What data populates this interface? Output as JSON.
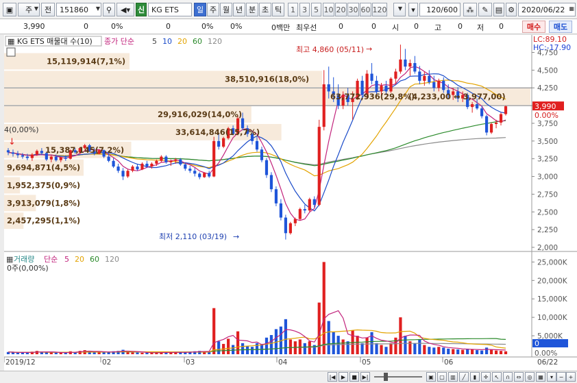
{
  "toolbar": {
    "period_label": "주",
    "prev_label": "전",
    "code_value": "151860",
    "trust_badge": "신",
    "stock_name": "KG ETS",
    "period_tabs": [
      "일",
      "주",
      "월",
      "년",
      "분",
      "초",
      "틱"
    ],
    "minute_options": [
      "1",
      "3",
      "5",
      "10",
      "20",
      "30",
      "60",
      "120"
    ],
    "count_display": "120",
    "count_total": "/600",
    "date_value": "2020/06/22"
  },
  "info": {
    "price": "3,990",
    "change": "0",
    "change_pct": "0%",
    "change2": "0",
    "change2_pct": "0%",
    "trade_value": "0백만",
    "best_ask_label": "최우선",
    "best_ask": "0",
    "best_ask2": "0",
    "open_label": "시",
    "open": "0",
    "high_label": "고",
    "high": "0",
    "low_label": "저",
    "low": "0",
    "buy_label": "매수",
    "sell_label": "매도"
  },
  "price_panel": {
    "title": "KG ETS 매물대 수(10)",
    "legend_prefix": "종가 단순",
    "ma_periods": [
      "5",
      "10",
      "20",
      "60",
      "120"
    ],
    "lc_label": "LC:89.10",
    "hc_label": "HC:-17.90",
    "last_price_tag": "3,990",
    "last_pct_tag": "0.00%",
    "start_marker": "4(0,00%)",
    "high_annotation": "최고 4,860 (05/11)",
    "low_annotation": "최저 2,110 (03/19)",
    "y_ticks": [
      "4,750",
      "4,500",
      "4,250",
      "4,000",
      "3,750",
      "3,500",
      "3,250",
      "3,000",
      "2,750",
      "2,500",
      "2,250",
      "2,000"
    ],
    "volume_profile": [
      {
        "label": "15,119,914(7,1%)",
        "price_low": 4500,
        "price_high": 4750,
        "share": 0.071
      },
      {
        "label": "38,510,916(18,0%)",
        "price_low": 4250,
        "price_high": 4500,
        "share": 0.18
      },
      {
        "label": "63,772,936(29,8%)",
        "price_low": 4000,
        "price_high": 4250,
        "share": 0.298
      },
      {
        "label": "29,916,029(14,0%)",
        "price_low": 3750,
        "price_high": 4000,
        "share": 0.14
      },
      {
        "label": "33,614,846(15,7%)",
        "price_low": 3500,
        "price_high": 3750,
        "share": 0.157
      },
      {
        "label": "15,387,145(7,2%)",
        "price_low": 3250,
        "price_high": 3500,
        "share": 0.072
      },
      {
        "label": "9,694,871(4,5%)",
        "price_low": 3000,
        "price_high": 3250,
        "share": 0.045
      },
      {
        "label": "1,952,375(0,9%)",
        "price_low": 2750,
        "price_high": 3000,
        "share": 0.009
      },
      {
        "label": "3,913,079(1,8%)",
        "price_low": 2500,
        "price_high": 2750,
        "share": 0.018
      },
      {
        "label": "2,457,295(1,1%)",
        "price_low": 2250,
        "price_high": 2500,
        "share": 0.011
      }
    ],
    "extra_label": "(4,233,00 ↔ 3,977,00)"
  },
  "volume_panel": {
    "title": "거래량",
    "legend_prefix": "단순",
    "ma_periods": [
      "5",
      "20",
      "60",
      "120"
    ],
    "start_marker": "0주(0,00%)",
    "y_ticks": [
      "25,000K",
      "20,000K",
      "15,000K",
      "10,000K",
      "5,000K",
      "0.00%"
    ],
    "last_tag": "0"
  },
  "x_axis": {
    "labels": [
      "2019/12",
      "02",
      "03",
      "04",
      "05",
      "06",
      "06/22"
    ]
  },
  "colors": {
    "up": "#e02020",
    "down": "#1f55d9",
    "ma5": "#c2237c",
    "ma10": "#1a4bc9",
    "ma20": "#e3a300",
    "ma60": "#2a8a2a",
    "ma120": "#8a8a8a",
    "profile": "#f7eadb"
  },
  "chart_data": {
    "type": "candlestick",
    "x_start": "2019-12-02",
    "x_end": "2020-06-22",
    "ylim": [
      2000,
      4900
    ],
    "volume_ylim": [
      0,
      26000
    ],
    "high": 4860,
    "high_date": "2020-05-11",
    "low": 2110,
    "low_date": "2020-03-19",
    "candles": [
      [
        3370,
        3400,
        3300,
        3340
      ],
      [
        3340,
        3380,
        3280,
        3320
      ],
      [
        3320,
        3360,
        3260,
        3300
      ],
      [
        3300,
        3330,
        3250,
        3280
      ],
      [
        3280,
        3320,
        3230,
        3260
      ],
      [
        3260,
        3330,
        3220,
        3310
      ],
      [
        3310,
        3380,
        3290,
        3360
      ],
      [
        3360,
        3400,
        3300,
        3330
      ],
      [
        3330,
        3350,
        3220,
        3240
      ],
      [
        3240,
        3300,
        3200,
        3280
      ],
      [
        3280,
        3310,
        3210,
        3230
      ],
      [
        3230,
        3280,
        3200,
        3270
      ],
      [
        3270,
        3300,
        3220,
        3250
      ],
      [
        3250,
        3380,
        3240,
        3370
      ],
      [
        3370,
        3400,
        3320,
        3340
      ],
      [
        3340,
        3410,
        3320,
        3400
      ],
      [
        3400,
        3460,
        3380,
        3440
      ],
      [
        3440,
        3460,
        3340,
        3360
      ],
      [
        3360,
        3400,
        3300,
        3320
      ],
      [
        3320,
        3380,
        3310,
        3370
      ],
      [
        3370,
        3380,
        3260,
        3280
      ],
      [
        3280,
        3330,
        3200,
        3220
      ],
      [
        3220,
        3260,
        3120,
        3140
      ],
      [
        3140,
        3180,
        3050,
        3080
      ],
      [
        3080,
        3120,
        2950,
        3000
      ],
      [
        3000,
        3100,
        2980,
        3080
      ],
      [
        3080,
        3160,
        3060,
        3140
      ],
      [
        3140,
        3180,
        3080,
        3100
      ],
      [
        3100,
        3200,
        3090,
        3180
      ],
      [
        3180,
        3220,
        3120,
        3140
      ],
      [
        3140,
        3200,
        3110,
        3180
      ],
      [
        3180,
        3240,
        3150,
        3220
      ],
      [
        3220,
        3300,
        3200,
        3280
      ],
      [
        3280,
        3300,
        3180,
        3200
      ],
      [
        3200,
        3240,
        3150,
        3220
      ],
      [
        3220,
        3260,
        3180,
        3240
      ],
      [
        3240,
        3260,
        3150,
        3170
      ],
      [
        3170,
        3200,
        3080,
        3110
      ],
      [
        3110,
        3150,
        3050,
        3080
      ],
      [
        3080,
        3120,
        3000,
        3040
      ],
      [
        3040,
        3060,
        2960,
        2990
      ],
      [
        2990,
        3060,
        2980,
        3050
      ],
      [
        3050,
        3080,
        2980,
        3000
      ],
      [
        3000,
        3560,
        2990,
        3500
      ],
      [
        3500,
        3600,
        3380,
        3420
      ],
      [
        3420,
        3560,
        3400,
        3540
      ],
      [
        3540,
        3700,
        3520,
        3680
      ],
      [
        3680,
        3720,
        3580,
        3600
      ],
      [
        3600,
        3860,
        3580,
        3820
      ],
      [
        3820,
        3900,
        3650,
        3680
      ],
      [
        3680,
        3720,
        3560,
        3600
      ],
      [
        3600,
        3640,
        3450,
        3500
      ],
      [
        3500,
        3560,
        3350,
        3380
      ],
      [
        3380,
        3420,
        3200,
        3230
      ],
      [
        3230,
        3260,
        2980,
        3020
      ],
      [
        3020,
        3060,
        2780,
        2820
      ],
      [
        2820,
        2860,
        2580,
        2620
      ],
      [
        2620,
        2680,
        2380,
        2420
      ],
      [
        2420,
        2460,
        2110,
        2200
      ],
      [
        2200,
        2360,
        2180,
        2340
      ],
      [
        2340,
        2420,
        2300,
        2400
      ],
      [
        2400,
        2560,
        2380,
        2540
      ],
      [
        2540,
        2600,
        2480,
        2520
      ],
      [
        2520,
        2700,
        2500,
        2680
      ],
      [
        2680,
        2720,
        2560,
        2600
      ],
      [
        2600,
        3800,
        2580,
        3700
      ],
      [
        3700,
        4500,
        3650,
        4300
      ],
      [
        4300,
        4550,
        4100,
        4200
      ],
      [
        4200,
        4400,
        4050,
        4150
      ],
      [
        4150,
        4300,
        3950,
        4000
      ],
      [
        4000,
        4200,
        3950,
        4150
      ],
      [
        4150,
        4250,
        4000,
        4050
      ],
      [
        4050,
        4200,
        3800,
        4100
      ],
      [
        4100,
        4380,
        4080,
        4350
      ],
      [
        4350,
        4420,
        4100,
        4150
      ],
      [
        4150,
        4500,
        4100,
        4450
      ],
      [
        4450,
        4600,
        4300,
        4350
      ],
      [
        4350,
        4420,
        4150,
        4200
      ],
      [
        4200,
        4320,
        4120,
        4280
      ],
      [
        4280,
        4350,
        4150,
        4200
      ],
      [
        4200,
        4400,
        4180,
        4380
      ],
      [
        4380,
        4520,
        4300,
        4480
      ],
      [
        4480,
        4860,
        4450,
        4650
      ],
      [
        4650,
        4800,
        4500,
        4550
      ],
      [
        4550,
        4650,
        4420,
        4600
      ],
      [
        4600,
        4700,
        4450,
        4480
      ],
      [
        4480,
        4560,
        4300,
        4350
      ],
      [
        4350,
        4480,
        4280,
        4420
      ],
      [
        4420,
        4500,
        4300,
        4330
      ],
      [
        4330,
        4420,
        4200,
        4250
      ],
      [
        4250,
        4380,
        4200,
        4350
      ],
      [
        4350,
        4400,
        4180,
        4220
      ],
      [
        4220,
        4300,
        4100,
        4150
      ],
      [
        4150,
        4250,
        4080,
        4200
      ],
      [
        4200,
        4260,
        4050,
        4100
      ],
      [
        4100,
        4200,
        4050,
        4150
      ],
      [
        4150,
        4180,
        3950,
        3980
      ],
      [
        3980,
        4050,
        3900,
        4020
      ],
      [
        4020,
        4100,
        3940,
        3960
      ],
      [
        3960,
        4000,
        3820,
        3850
      ],
      [
        3850,
        3870,
        3580,
        3620
      ],
      [
        3620,
        3760,
        3600,
        3740
      ],
      [
        3740,
        3800,
        3680,
        3760
      ],
      [
        3760,
        3900,
        3720,
        3880
      ],
      [
        3880,
        4000,
        3860,
        3990
      ]
    ],
    "volumes": [
      600,
      500,
      400,
      450,
      420,
      700,
      900,
      600,
      500,
      450,
      400,
      380,
      420,
      800,
      650,
      900,
      1100,
      700,
      500,
      600,
      550,
      700,
      800,
      900,
      1200,
      600,
      500,
      450,
      400,
      420,
      380,
      400,
      600,
      500,
      450,
      420,
      500,
      600,
      700,
      800,
      900,
      700,
      600,
      12500,
      3500,
      2800,
      4200,
      2500,
      6200,
      3000,
      2200,
      2000,
      3000,
      2800,
      4500,
      5200,
      6800,
      7500,
      9500,
      4000,
      3500,
      4000,
      3000,
      3500,
      2500,
      14000,
      25000,
      9000,
      6000,
      5000,
      4000,
      3500,
      6500,
      5000,
      3000,
      4500,
      6000,
      3000,
      2500,
      2000,
      3000,
      4500,
      10000,
      5000,
      3500,
      3000,
      4000,
      2500,
      2000,
      1800,
      2000,
      1800,
      1500,
      1400,
      1300,
      1200,
      1500,
      1300,
      1100,
      1000,
      1800,
      1200,
      1000,
      900,
      800
    ]
  }
}
